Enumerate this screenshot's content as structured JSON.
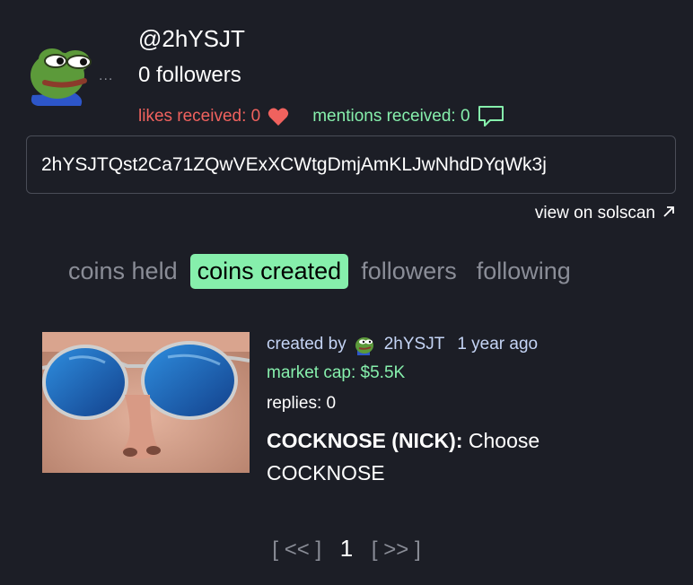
{
  "profile": {
    "username": "@2hYSJT",
    "followers_text": "0 followers",
    "dots": "...",
    "likes_text": "likes received: 0",
    "mentions_text": "mentions received: 0",
    "address": "2hYSJTQst2Ca71ZQwVExXCWtgDmjAmKLJwNhdDYqWk3j",
    "solscan_label": "view on solscan",
    "solscan_icon": "external-link-icon"
  },
  "tabs": [
    {
      "label": "coins held",
      "active": false
    },
    {
      "label": "coins created",
      "active": true
    },
    {
      "label": "followers",
      "active": false
    },
    {
      "label": "following",
      "active": false
    }
  ],
  "coin": {
    "created_by_label": "created by",
    "creator_handle": "2hYSJT",
    "created_ago": "1 year ago",
    "market_cap": "market cap: $5.5K",
    "replies": "replies: 0",
    "name": "COCKNOSE (NICK):",
    "description": "Choose COCKNOSE"
  },
  "pagination": {
    "prev": "[ << ]",
    "current": "1",
    "next": "[ >> ]"
  },
  "colors": {
    "background": "#1c1e26",
    "accent_green": "#86efac",
    "likes_red": "#f0625e",
    "muted": "#8a8d97",
    "creator_blue": "#c4d4f5"
  }
}
